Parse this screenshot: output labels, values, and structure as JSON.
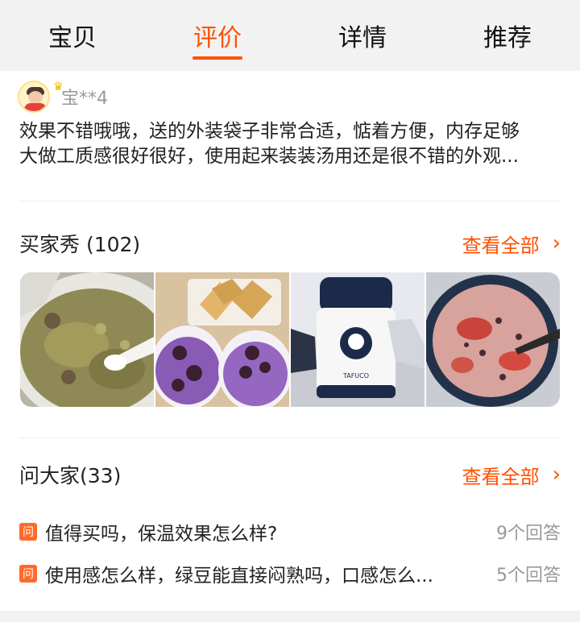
{
  "tabs": [
    {
      "label": "宝贝",
      "active": false
    },
    {
      "label": "评价",
      "active": true
    },
    {
      "label": "详情",
      "active": false
    },
    {
      "label": "推荐",
      "active": false
    }
  ],
  "review": {
    "username": "宝**4",
    "avatar_icon": "child-avatar-icon",
    "badge_icon": "crown-icon",
    "text_line1": "效果不错哦哦，送的外装袋子非常合适，惦着方便，内存足够",
    "text_line2": "大做工质感很好很好，使用起来装装汤用还是很不错的外观..."
  },
  "buyer_show": {
    "title": "买家秀 (102)",
    "view_all": "查看全部",
    "chevron": "›",
    "photos": [
      {
        "icon": "mung-bean-porridge-photo"
      },
      {
        "icon": "purple-rice-bowls-photo"
      },
      {
        "icon": "food-jar-thermos-photo"
      },
      {
        "icon": "bean-porridge-bowl-photo"
      }
    ]
  },
  "qa": {
    "title": "问大家(33)",
    "view_all": "查看全部",
    "chevron": "›",
    "badge": "问",
    "items": [
      {
        "question": "值得买吗，保温效果怎么样?",
        "answers": "9个回答"
      },
      {
        "question": "使用感怎么样，绿豆能直接闷熟吗，口感怎么...",
        "answers": "5个回答"
      }
    ]
  },
  "colors": {
    "accent": "#ff5000",
    "muted": "#999999",
    "background": "#f2f2f2"
  }
}
